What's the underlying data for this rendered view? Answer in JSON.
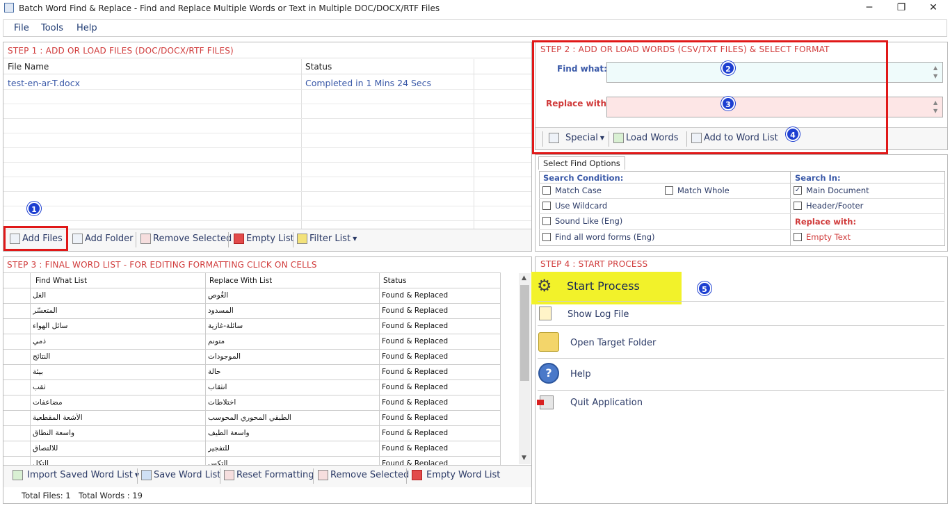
{
  "window": {
    "title": "Batch Word Find & Replace - Find and Replace Multiple Words or Text  in Multiple DOC/DOCX/RTF Files",
    "min": "─",
    "max": "❐",
    "close": "✕"
  },
  "menu": [
    "File",
    "Tools",
    "Help"
  ],
  "step1": {
    "title": "STEP 1 : ADD OR LOAD FILES (DOC/DOCX/RTF FILES)",
    "col_file": "File Name",
    "col_status": "Status",
    "rows": [
      {
        "file": "test-en-ar-T.docx",
        "status": "Completed in 1 Mins 24 Secs"
      }
    ],
    "toolbar": {
      "add_files": "Add Files",
      "add_folder": "Add Folder",
      "remove_selected": "Remove Selected",
      "empty_list": "Empty List",
      "filter_list": "Filter List"
    }
  },
  "step2": {
    "title": "STEP 2 : ADD OR LOAD WORDS (CSV/TXT FILES) & SELECT FORMAT",
    "find_label": "Find what:",
    "replace_label": "Replace with:",
    "find_value": "",
    "replace_value": "",
    "toolbar": {
      "special": "Special",
      "load_words": "Load Words",
      "add_to_list": "Add to Word List"
    }
  },
  "options": {
    "tab": "Select Find Options",
    "search_condition": "Search Condition:",
    "search_in": "Search In:",
    "replace_with": "Replace with:",
    "match_case": "Match Case",
    "match_whole": "Match Whole",
    "use_wildcard": "Use Wildcard",
    "sound_like": "Sound Like (Eng)",
    "find_all_forms": "Find all word forms (Eng)",
    "main_document": "Main Document",
    "header_footer": "Header/Footer",
    "empty_text": "Empty Text",
    "checked_main_document": true
  },
  "step3": {
    "title": "STEP 3 : FINAL WORD LIST - FOR EDITING FORMATTING CLICK ON CELLS",
    "col_find": "Find What List",
    "col_replace": "Replace With List",
    "col_status": "Status",
    "rows": [
      {
        "find": "الغل",
        "replace": "الغُوص",
        "status": "Found & Replaced"
      },
      {
        "find": "المتعسّر",
        "replace": "المسدود",
        "status": "Found & Replaced"
      },
      {
        "find": "سائل الهواء",
        "replace": "سائلة-غازية",
        "status": "Found & Replaced"
      },
      {
        "find": "ذمي",
        "replace": "متونم",
        "status": "Found & Replaced"
      },
      {
        "find": "النتائج",
        "replace": "الموجودات",
        "status": "Found & Replaced"
      },
      {
        "find": "بيئة",
        "replace": "حالة",
        "status": "Found & Replaced"
      },
      {
        "find": "ثقب",
        "replace": "انثقاب",
        "status": "Found & Replaced"
      },
      {
        "find": "مضاعفات",
        "replace": "اختلاطات",
        "status": "Found & Replaced"
      },
      {
        "find": "الأشعة المقطعية",
        "replace": "الطبقي المحوري المحوسب",
        "status": "Found & Replaced"
      },
      {
        "find": "واسعة النطاق",
        "replace": "واسعة الطيف",
        "status": "Found & Replaced"
      },
      {
        "find": "للالتصاق",
        "replace": "للتفجير",
        "status": "Found & Replaced"
      },
      {
        "find": "التكل",
        "replace": "التكس",
        "status": "Found & Replaced"
      }
    ],
    "toolbar": {
      "import_saved": "Import Saved Word List",
      "save_list": "Save Word List",
      "reset_formatting": "Reset Formatting",
      "remove_selected": "Remove Selected",
      "empty_list": "Empty Word List"
    },
    "status": {
      "total_files": "Total Files: 1",
      "total_words": "Total Words : 19"
    }
  },
  "step4": {
    "title": "STEP 4 : START PROCESS",
    "start": "Start Process",
    "show_log": "Show Log File",
    "open_target": "Open Target Folder",
    "help": "Help",
    "quit": "Quit Application"
  },
  "badges": [
    "1",
    "2",
    "3",
    "4",
    "5"
  ],
  "colors": {
    "accent_red": "#d03a3a",
    "label_blue": "#3a59a8",
    "highlight_yellow": "#f2f22a",
    "find_bg": "#effbfb",
    "replace_bg": "#fde6e6"
  }
}
